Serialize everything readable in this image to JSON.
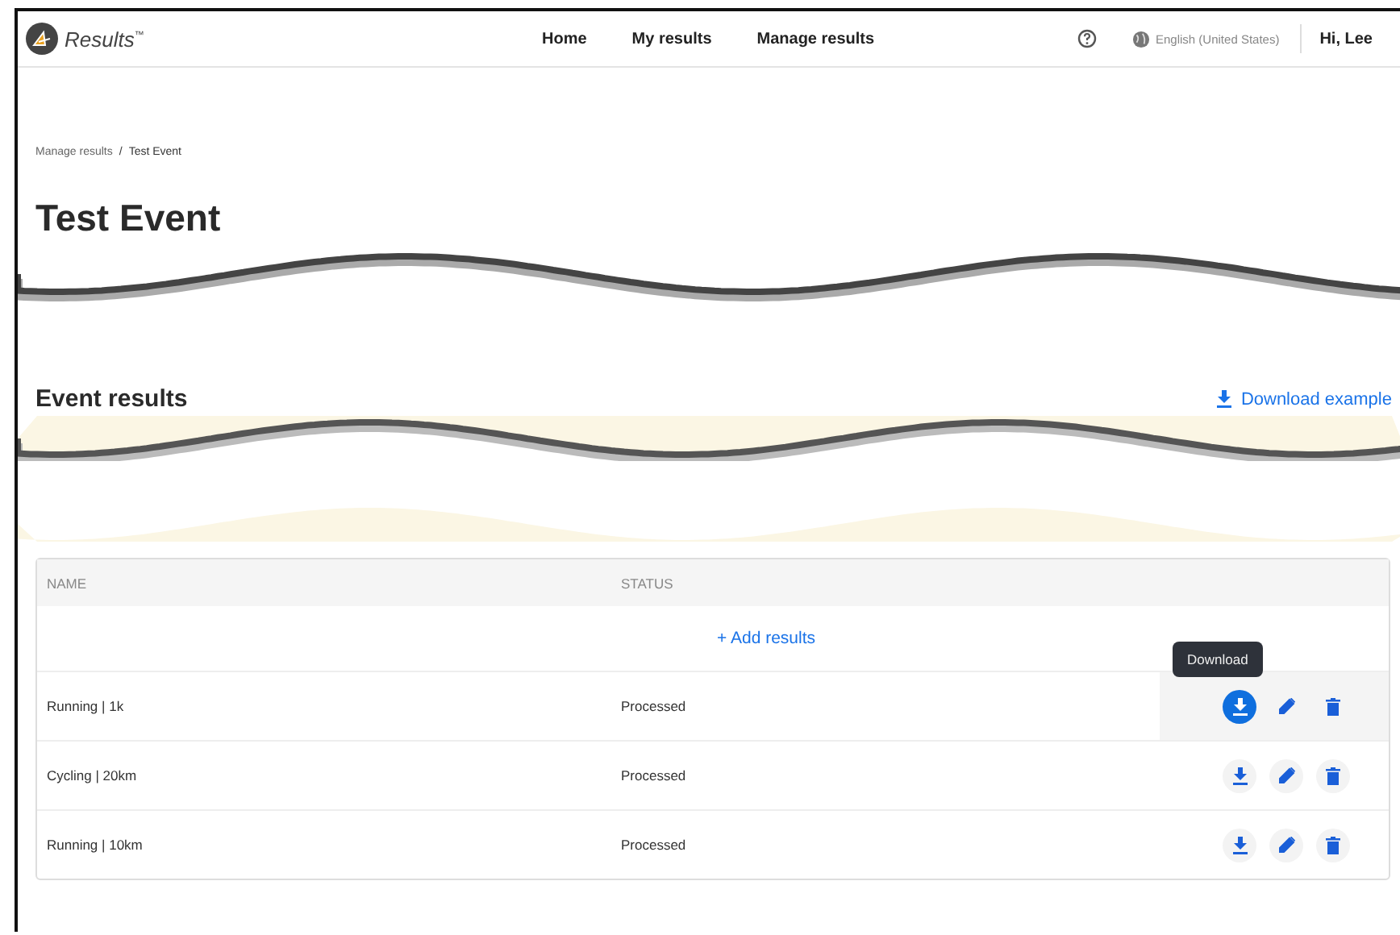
{
  "header": {
    "logo": "Results$^{™}$",
    "nav": [
      {
        "label": "Home"
      },
      {
        "label": "My results"
      },
      {
        "label": "Manage results"
      }
    ],
    "language": "English (United States)",
    "greeting": "Hi, Lee"
  },
  "breadcrumb": [
    {
      "label": "Manage results",
      "kind": "link"
    },
    {
      "label": "Test Event",
      "kind": "current"
    }
  ],
  "breadcrumb_separator": "/",
  "title": "Test Event",
  "section": {
    "title": "Event results",
    "action": "Download example"
  },
  "table": {
    "columns": [
      "NAME",
      "STATUS"
    ],
    "add_label": "+ Add results",
    "tooltip": "Download",
    "rows": [
      {
        "name": "Running | 1k",
        "status": "Processed",
        "hovered": true
      },
      {
        "name": "Cycling | 20km",
        "status": "Processed",
        "hovered": false
      },
      {
        "name": "Running | 10km",
        "status": "Processed",
        "hovered": false
      }
    ]
  }
}
